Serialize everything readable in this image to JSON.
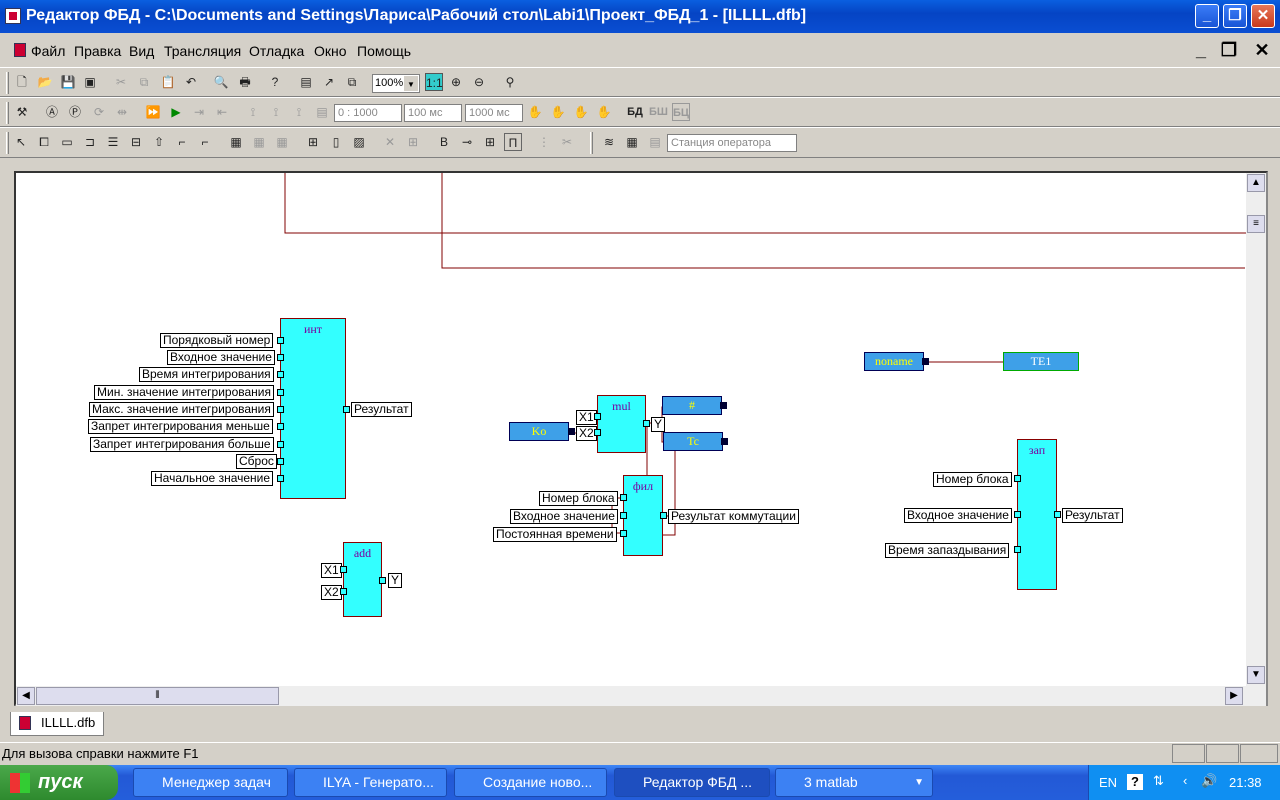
{
  "window": {
    "title": "Редактор ФБД - C:\\Documents and Settings\\Лариса\\Рабочий стол\\Labi1\\Проект_ФБД_1 - [ILLLL.dfb]"
  },
  "menu": [
    "Файл",
    "Правка",
    "Вид",
    "Трансляция",
    "Отладка",
    "Окно",
    "Помощь"
  ],
  "toolbar1": {
    "zoom": "100%"
  },
  "toolbar2": {
    "range": "0 : 1000",
    "step1": "100 мс",
    "step2": "1000 мс",
    "mode1": "БД",
    "mode2": "БШ",
    "mode3": "БЦ"
  },
  "toolbar3": {
    "station_placeholder": "Станция оператора"
  },
  "diagram": {
    "int": {
      "name": "инт",
      "inputs": [
        "Порядковый номер",
        "Входное значение",
        "Время интегрирования",
        "Мин. значение интегрирования",
        "Макс. значение интегрирования",
        "Запрет интегрирования меньше",
        "Запрет интегрирования больше",
        "Сброс",
        "Начальное значение"
      ],
      "output": "Результат"
    },
    "add": {
      "name": "add",
      "in1": "X1",
      "in2": "X2",
      "out": "Y"
    },
    "mul": {
      "name": "mul",
      "in1": "X1",
      "in2": "X2",
      "out": "Y"
    },
    "fil": {
      "name": "фил",
      "inputs": [
        "Номер блока",
        "Входное значение",
        "Постоянная времени"
      ],
      "output": "Результат коммутации"
    },
    "zap": {
      "name": "зап",
      "inputs": [
        "Номер блока",
        "Входное значение",
        "Время запаздывания"
      ],
      "output": "Результат"
    },
    "vars": {
      "ko": "Ko",
      "hash": "#",
      "tc": "Tc",
      "noname": "noname",
      "te1": "TE1"
    }
  },
  "doc_tab": "ILLLL.dfb",
  "status": "Для вызова справки нажмите F1",
  "taskbar": {
    "start": "пуск",
    "tasks": [
      "Менеджер задач",
      "ILYA - Генерато...",
      "Создание ново...",
      "Редактор ФБД ...",
      "3 matlab"
    ],
    "lang": "EN",
    "clock": "21:38"
  },
  "colors": {
    "block_fill": "#33ffff",
    "var_fill": "#3ea0e8",
    "wire": "#800000",
    "titlebar": "#0a4ed2"
  }
}
